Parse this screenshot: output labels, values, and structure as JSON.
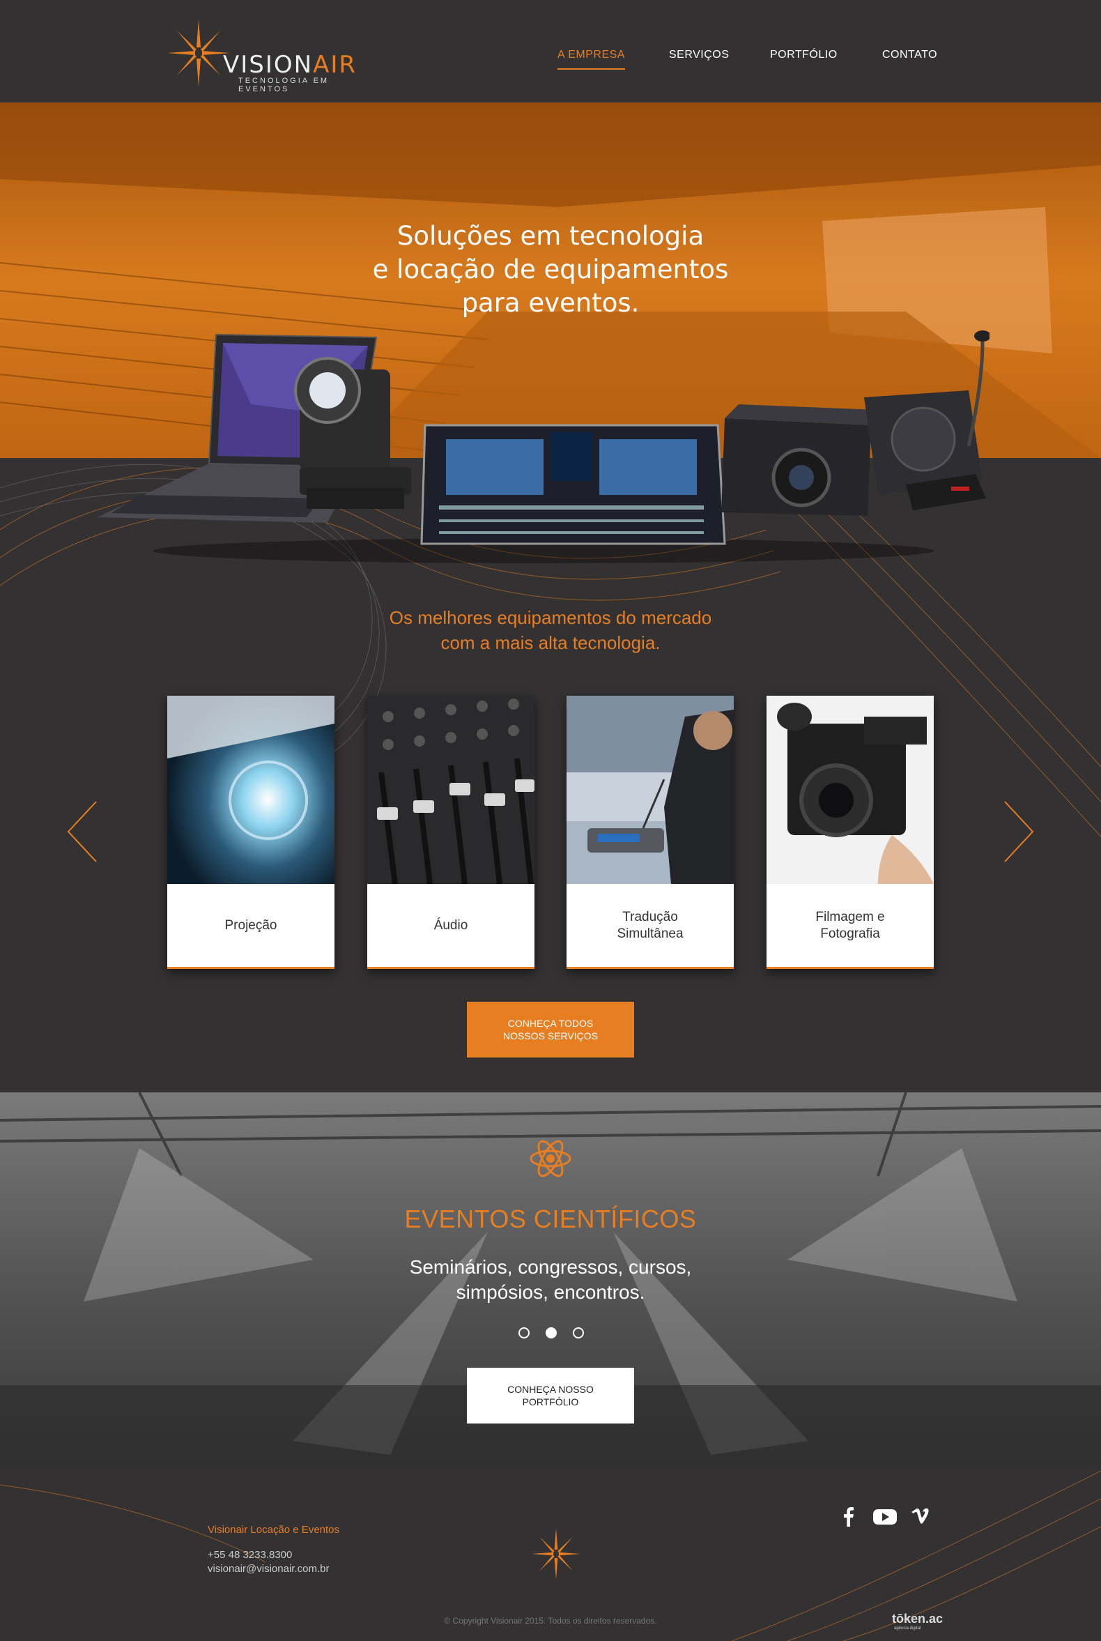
{
  "colors": {
    "accent": "#e87e22",
    "background": "#333132",
    "card": "#ffffff"
  },
  "brand": {
    "name_main": "VISION",
    "name_accent": "AIR",
    "tagline": "TECNOLOGIA EM EVENTOS"
  },
  "nav": {
    "items": [
      {
        "label": "A EMPRESA",
        "active": true
      },
      {
        "label": "SERVIÇOS",
        "active": false
      },
      {
        "label": "PORTFÓLIO",
        "active": false
      },
      {
        "label": "CONTATO",
        "active": false
      }
    ]
  },
  "hero": {
    "title": "Soluções em tecnologia\ne locação de equipamentos\npara eventos."
  },
  "services": {
    "tagline": "Os melhores equipamentos do mercado\ncom a mais alta tecnologia.",
    "cards": [
      {
        "label": "Projeção",
        "icon": "projector-lens-photo"
      },
      {
        "label": "Áudio",
        "icon": "mixer-faders-photo"
      },
      {
        "label": "Tradução\nSimultânea",
        "icon": "conference-mic-photo"
      },
      {
        "label": "Filmagem e\nFotografia",
        "icon": "video-camera-photo"
      }
    ],
    "prev_icon": "chevron-left-icon",
    "next_icon": "chevron-right-icon",
    "button_label": "CONHEÇA TODOS\nNOSSOS SERVIÇOS"
  },
  "events": {
    "icon": "atom-icon",
    "title": "EVENTOS CIENTÍFICOS",
    "subtitle": "Seminários, congressos, cursos,\nsimpósios, encontros.",
    "active_slide": 2,
    "slide_count": 3,
    "button_label": "CONHEÇA NOSSO\nPORTFÓLIO"
  },
  "footer": {
    "company": "Visionair Locação e Eventos",
    "phone": "+55 48 3233.8300",
    "email": "visionair@visionair.com.br",
    "social": [
      "facebook-icon",
      "youtube-icon",
      "vimeo-icon"
    ],
    "copyright": "© Copyright Visionair 2015. Todos os direitos reservados.",
    "credit": "tōken.ac",
    "credit_sub": "agência digital"
  }
}
